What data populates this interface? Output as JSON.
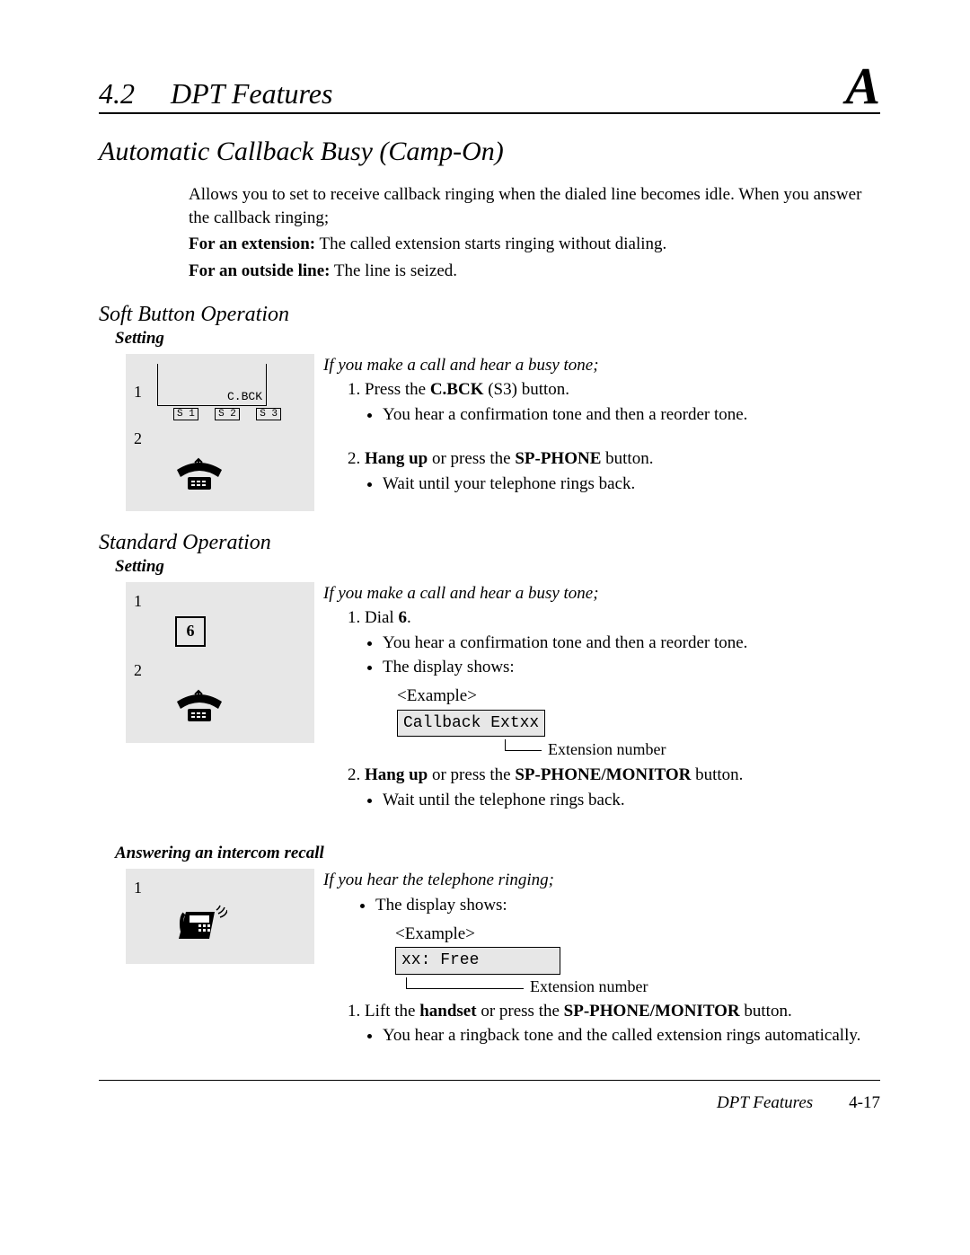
{
  "header": {
    "section_num": "4.2",
    "section_title": "DPT Features",
    "index_letter": "A"
  },
  "title": "Automatic Callback Busy (Camp-On)",
  "intro": {
    "p1": "Allows you to set to receive callback ringing when the dialed line becomes idle.  When you answer the callback ringing;",
    "ext_label": "For an extension:",
    "ext_text": " The called extension starts ringing without dialing.",
    "out_label": "For an outside line:",
    "out_text": " The line is seized."
  },
  "soft": {
    "heading": "Soft Button Operation",
    "setting": "Setting",
    "diagram": {
      "n1": "1",
      "n2": "2",
      "cbck": "C.BCK",
      "s1": "S 1",
      "s2": "S 2",
      "s3": "S 3"
    },
    "cond": "If you make a call and hear a busy tone;",
    "step1_pre": "Press the ",
    "step1_bold": "C.BCK",
    "step1_post": " (S3) button.",
    "step1_bul": "You hear a confirmation tone and then a reorder tone.",
    "step2_bold1": "Hang up",
    "step2_mid": " or press the ",
    "step2_bold2": "SP-PHONE",
    "step2_post": " button.",
    "step2_bul": "Wait until your telephone rings back."
  },
  "std": {
    "heading": "Standard Operation",
    "setting": "Setting",
    "diagram": {
      "n1": "1",
      "n2": "2",
      "key": "6"
    },
    "cond": "If you make a call and hear a busy tone;",
    "step1_pre": "Dial ",
    "step1_bold": "6",
    "step1_post": ".",
    "step1_bul1": "You hear a confirmation tone and then a reorder tone.",
    "step1_bul2": "The display shows:",
    "example_label": "<Example>",
    "display1": "Callback Extxx",
    "pointer1": "Extension number",
    "step2_bold1": "Hang up",
    "step2_mid": " or press the ",
    "step2_bold2": "SP-PHONE/MONITOR",
    "step2_post": " button.",
    "step2_bul": "Wait until the telephone rings back."
  },
  "answer": {
    "heading": "Answering an intercom recall",
    "diagram": {
      "n1": "1"
    },
    "cond": "If you hear the telephone ringing;",
    "bul0": "The display shows:",
    "example_label": "<Example>",
    "display2": "xx: Free",
    "pointer2": "Extension number",
    "step1_pre": "Lift the ",
    "step1_bold1": "handset",
    "step1_mid": " or press the ",
    "step1_bold2": "SP-PHONE/MONITOR",
    "step1_post": " button.",
    "step1_bul": "You hear a ringback tone and the called extension rings automatically."
  },
  "footer": {
    "src": "DPT Features",
    "page": "4-17"
  }
}
